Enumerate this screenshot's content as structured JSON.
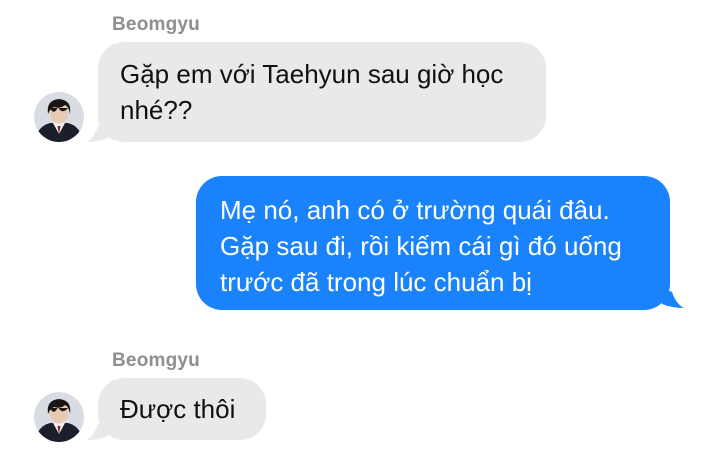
{
  "conversation": {
    "messages": [
      {
        "sender": "Beomgyu",
        "direction": "incoming",
        "lines": [
          "Gặp em với Taehyun sau giờ học",
          "nhé??"
        ]
      },
      {
        "direction": "outgoing",
        "lines": [
          "Mẹ nó, anh có ở trường quái đâu.",
          "Gặp sau đi, rồi kiếm cái gì đó uống",
          "trước đã trong lúc chuẩn bị"
        ]
      },
      {
        "sender": "Beomgyu",
        "direction": "incoming",
        "lines": [
          "Được thôi"
        ]
      }
    ]
  },
  "theme": {
    "incoming_bubble": "#e9e9eb",
    "outgoing_bubble": "#1a82fb",
    "sender_name_color": "#8e8e93"
  },
  "icons": {
    "avatar": "contact-avatar-photo"
  }
}
